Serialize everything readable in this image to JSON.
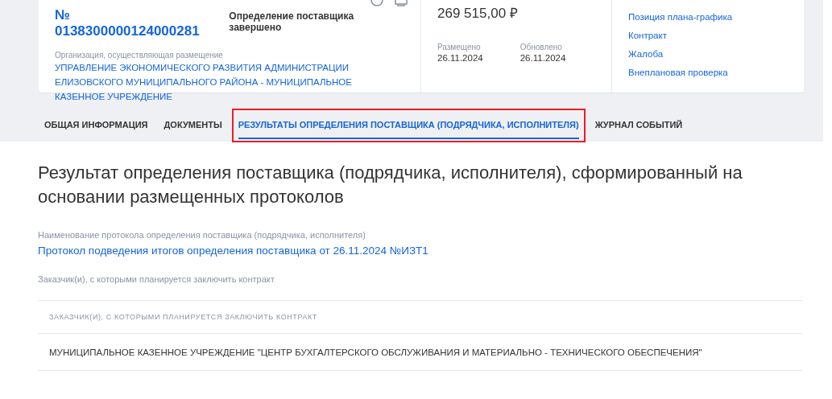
{
  "card": {
    "number": "№ 0138300000124000281",
    "status": "Определение поставщика завершено",
    "org_label": "Организация, осуществляющая размещение",
    "org_name": "УПРАВЛЕНИЕ ЭКОНОМИЧЕСКОГО РАЗВИТИЯ АДМИНИСТРАЦИИ ЕЛИЗОВСКОГО МУНИЦИПАЛЬНОГО РАЙОНА - МУНИЦИПАЛЬНОЕ КАЗЕННОЕ УЧРЕЖДЕНИЕ",
    "price": "269 515,00 ₽",
    "dates": [
      {
        "label": "Размещено",
        "value": "26.11.2024"
      },
      {
        "label": "Обновлено",
        "value": "26.11.2024"
      }
    ],
    "links": [
      "Позиция плана-графика",
      "Контракт",
      "Жалоба",
      "Внеплановая проверка"
    ]
  },
  "tabs": [
    {
      "label": "ОБЩАЯ ИНФОРМАЦИЯ",
      "selected": false,
      "outlined": false
    },
    {
      "label": "ДОКУМЕНТЫ",
      "selected": false,
      "outlined": false
    },
    {
      "label": "РЕЗУЛЬТАТЫ ОПРЕДЕЛЕНИЯ ПОСТАВЩИКА (ПОДРЯДЧИКА, ИСПОЛНИТЕЛЯ)",
      "selected": true,
      "outlined": true
    },
    {
      "label": "ЖУРНАЛ СОБЫТИЙ",
      "selected": false,
      "outlined": false
    }
  ],
  "heading": "Результат определения поставщика (подрядчика, исполнителя), сформированный на основании размещенных протоколов",
  "protocol": {
    "label": "Наименование протокола определения поставщика (подрядчика, исполнителя)",
    "link": "Протокол подведения итогов определения поставщика от 26.11.2024 №ИЗТ1"
  },
  "customers": {
    "label": "Заказчик(и), с которыми планируется заключить контракт",
    "table": {
      "columns": [
        "ЗАКАЗЧИК(И), С КОТОРЫМИ ПЛАНИРУЕТСЯ ЗАКЛЮЧИТЬ КОНТРАКТ"
      ],
      "rows": [
        [
          "МУНИЦИПАЛЬНОЕ КАЗЕННОЕ УЧРЕЖДЕНИЕ \"ЦЕНТР БУХГАЛТЕРСКОГО ОБСЛУЖИВАНИЯ И МАТЕРИАЛЬНО - ТЕХНИЧЕСКОГО ОБЕСПЕЧЕНИЯ\""
        ]
      ]
    }
  }
}
